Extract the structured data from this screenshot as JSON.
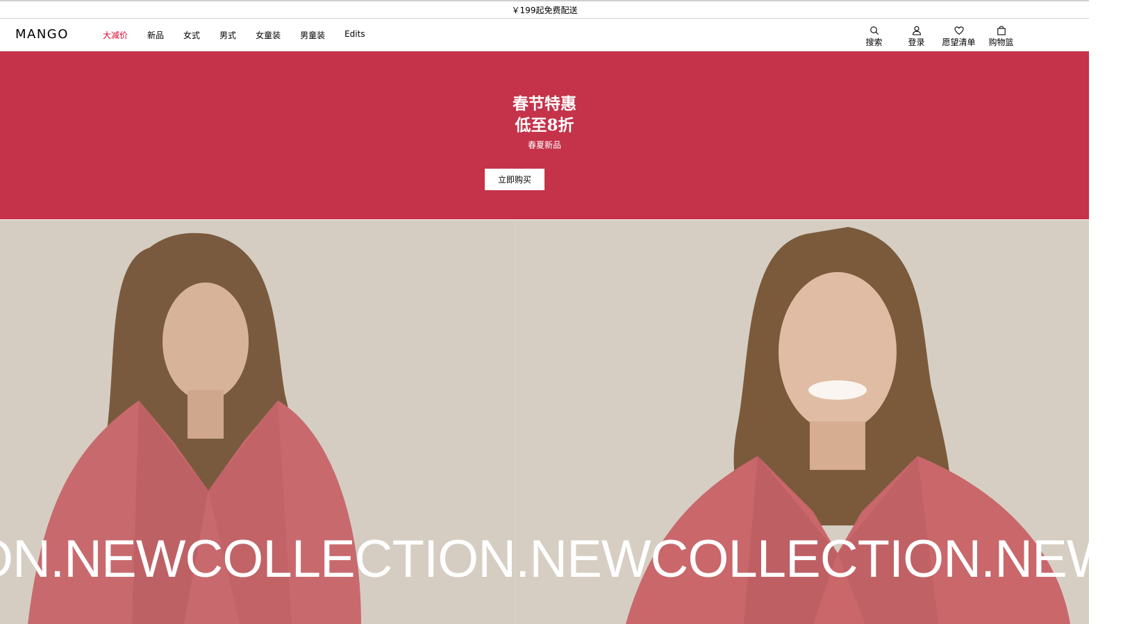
{
  "promo": {
    "text": "￥199起免费配送"
  },
  "header": {
    "logo": "MANGO",
    "nav": [
      {
        "label": "大减价"
      },
      {
        "label": "新品"
      },
      {
        "label": "女式"
      },
      {
        "label": "男式"
      },
      {
        "label": "女童装"
      },
      {
        "label": "男童装"
      },
      {
        "label": "Edits"
      }
    ],
    "actions": {
      "search": {
        "label": "搜索",
        "icon": "search-icon"
      },
      "login": {
        "label": "登录",
        "icon": "user-icon"
      },
      "wishlist": {
        "label": "愿望清单",
        "icon": "heart-icon"
      },
      "cart": {
        "label": "购物篮",
        "icon": "bag-icon"
      }
    },
    "sale_color": "#e0002a"
  },
  "banner": {
    "title_line1": "春节特惠",
    "title_line2": "低至8折",
    "subtitle": "春夏新品",
    "button": "立即购买",
    "background": "#c4334a"
  },
  "hero": {
    "marquee": "ON.NEWCOLLECTION.NEWCOLLECTION.NEW"
  }
}
